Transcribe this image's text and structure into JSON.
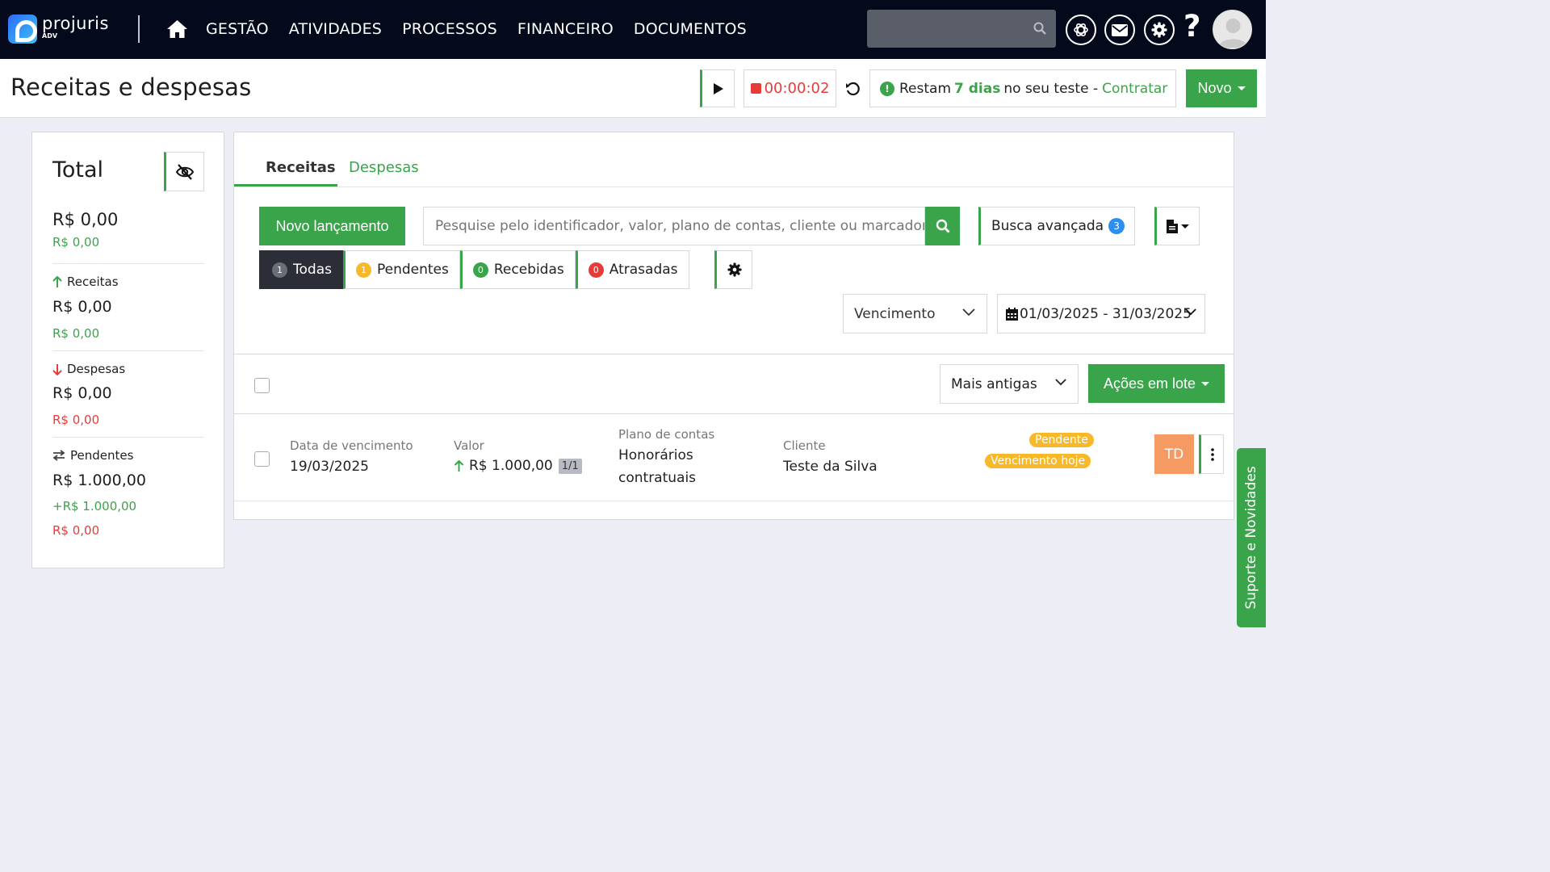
{
  "app": {
    "logo_name": "projuris",
    "logo_sub": "ADV",
    "brand_color": "#3aa44a"
  },
  "nav": {
    "home_icon": "home-icon",
    "links": [
      "GESTÃO",
      "ATIVIDADES",
      "PROCESSOS",
      "FINANCEIRO",
      "DOCUMENTOS"
    ],
    "search_placeholder": "",
    "icons": [
      "openai-icon",
      "mail-icon",
      "gear-icon",
      "help-icon",
      "user-avatar-icon"
    ]
  },
  "header": {
    "title": "Receitas e despesas",
    "timer": "00:00:02",
    "trial_prefix": "Restam",
    "trial_days": "7 dias",
    "trial_suffix": "no seu teste -",
    "trial_link": "Contratar",
    "new_button": "Novo"
  },
  "summary": {
    "title": "Total",
    "total": "R$ 0,00",
    "total_sub": "R$ 0,00",
    "receitas": {
      "label": "Receitas",
      "value": "R$ 0,00",
      "sub": "R$ 0,00"
    },
    "despesas": {
      "label": "Despesas",
      "value": "R$ 0,00",
      "sub": "R$ 0,00"
    },
    "pendentes": {
      "label": "Pendentes",
      "value": "R$ 1.000,00",
      "sub_plus": "+R$ 1.000,00",
      "sub_minus": "R$ 0,00"
    }
  },
  "main": {
    "tabs": [
      "Receitas",
      "Despesas"
    ],
    "active_tab": "Receitas",
    "new_entry_button": "Novo lançamento",
    "search_placeholder": "Pesquise pelo identificador, valor, plano de contas, cliente ou marcadores",
    "advanced_search": "Busca avançada",
    "advanced_search_count": "3",
    "filters": [
      {
        "label": "Todas",
        "count": "1",
        "color": "#6b6e78",
        "active": true
      },
      {
        "label": "Pendentes",
        "count": "1",
        "color": "#f7b82a",
        "active": false
      },
      {
        "label": "Recebidas",
        "count": "0",
        "color": "#3aa44a",
        "active": false
      },
      {
        "label": "Atrasadas",
        "count": "0",
        "color": "#e83b37",
        "active": false
      }
    ],
    "date_field_select": "Vencimento",
    "date_range": "01/03/2025 - 31/03/2025",
    "sort_select": "Mais antigas",
    "batch_actions": "Ações em lote"
  },
  "rows": [
    {
      "due_label": "Data de vencimento",
      "due_value": "19/03/2025",
      "value_label": "Valor",
      "value": "R$ 1.000,00",
      "installment": "1/1",
      "plan_label": "Plano de contas",
      "plan_value_line1": "Honorários",
      "plan_value_line2": "contratuais",
      "client_label": "Cliente",
      "client_value": "Teste da Silva",
      "status": "Pendente",
      "status_due": "Vencimento hoje",
      "initials": "TD"
    }
  ],
  "support_tab": "Suporte e Novidades"
}
